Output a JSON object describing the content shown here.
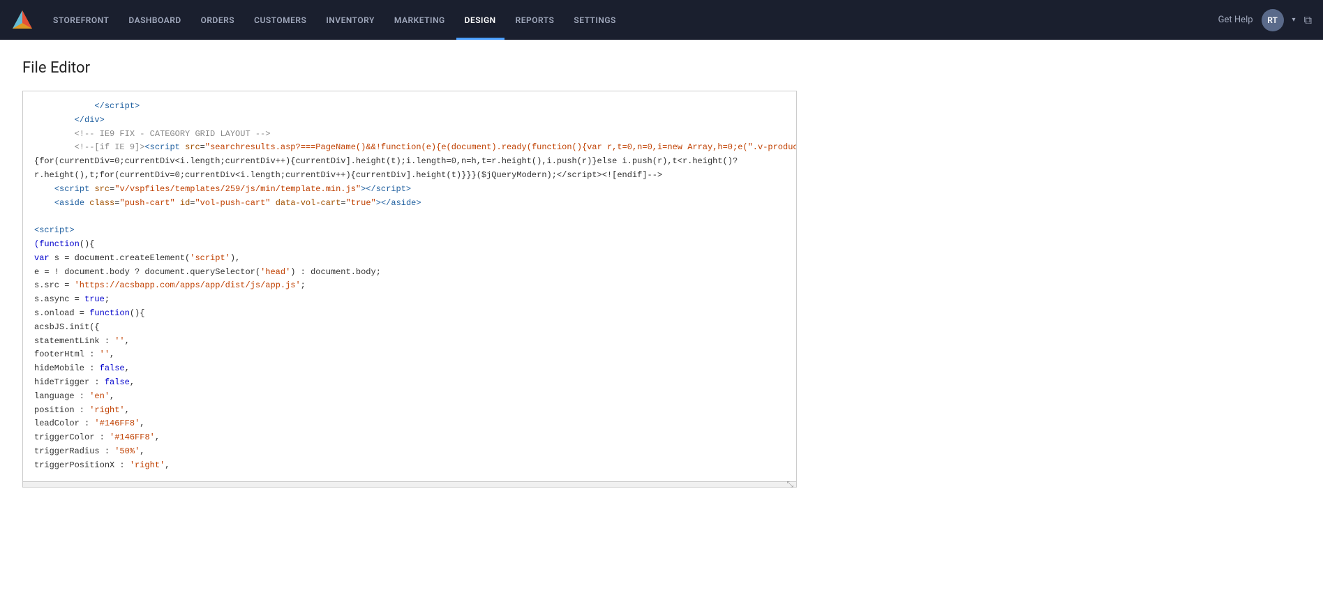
{
  "nav": {
    "items": [
      {
        "label": "STOREFRONT",
        "active": false
      },
      {
        "label": "DASHBOARD",
        "active": false
      },
      {
        "label": "ORDERS",
        "active": false
      },
      {
        "label": "CUSTOMERS",
        "active": false
      },
      {
        "label": "INVENTORY",
        "active": false
      },
      {
        "label": "MARKETING",
        "active": false
      },
      {
        "label": "DESIGN",
        "active": true
      },
      {
        "label": "REPORTS",
        "active": false
      },
      {
        "label": "SETTINGS",
        "active": false
      }
    ],
    "get_help": "Get Help",
    "avatar_initials": "RT"
  },
  "page": {
    "title": "File Editor"
  },
  "colors": {
    "nav_bg": "#1a1f2e",
    "active_underline": "#4a9eff"
  }
}
